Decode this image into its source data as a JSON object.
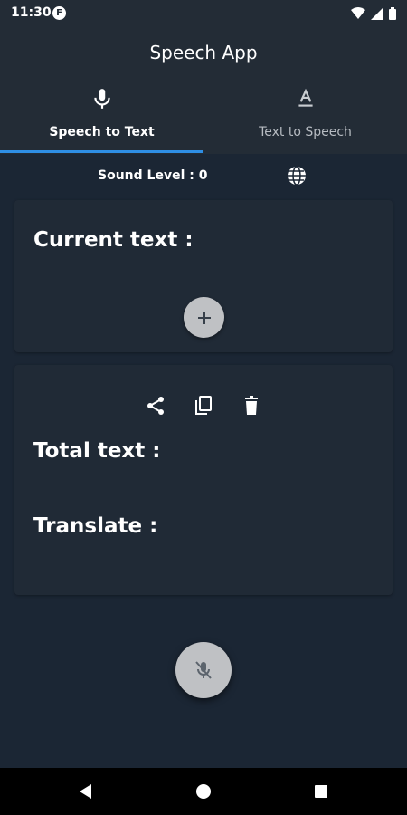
{
  "status": {
    "time": "11:30",
    "app_icon_letter": "F"
  },
  "app": {
    "title": "Speech App"
  },
  "tabs": [
    {
      "label": "Speech to Text",
      "icon": "mic-icon",
      "active": true
    },
    {
      "label": "Text to Speech",
      "icon": "text-format-icon",
      "active": false
    }
  ],
  "controls": {
    "sound_level": "Sound Level : 0",
    "language_icon": "globe-icon"
  },
  "card1": {
    "heading": "Current text :"
  },
  "card2": {
    "actions": [
      "share-icon",
      "copy-icon",
      "delete-icon"
    ],
    "total_heading": "Total text :",
    "translate_heading": "Translate :"
  },
  "fab": {
    "icon": "mic-off-icon"
  },
  "nav": {
    "buttons": [
      "back",
      "home",
      "recents"
    ]
  },
  "colors": {
    "accent": "#2e8ee4",
    "background": "#1b2634",
    "card": "#202a36",
    "button": "#bfc1c4"
  }
}
